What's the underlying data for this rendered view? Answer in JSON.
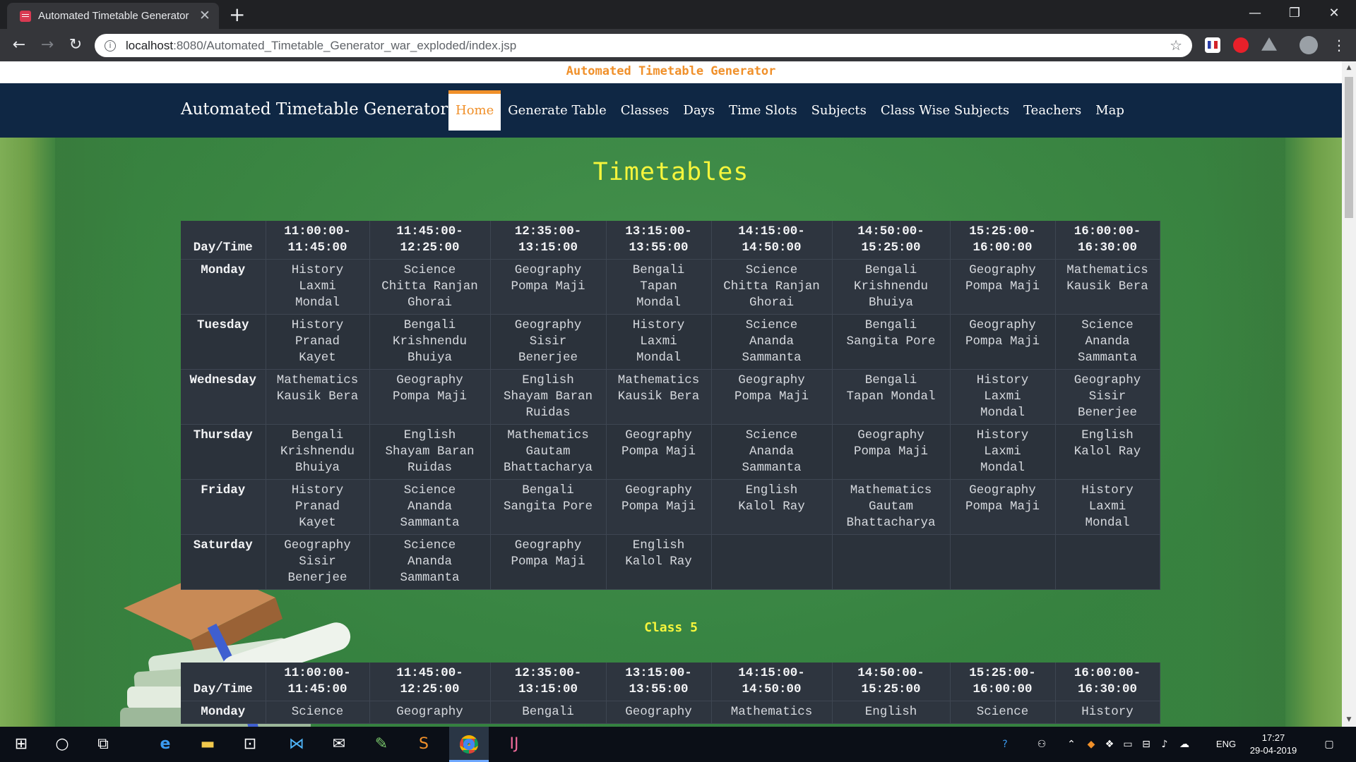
{
  "browser": {
    "tab_title": "Automated Timetable Generator",
    "tab_close": "✕",
    "new_tab": "+",
    "url_host": "localhost",
    "url_path": ":8080/Automated_Timetable_Generator_war_exploded/index.jsp",
    "win_min": "—",
    "win_max": "❐",
    "win_close": "✕"
  },
  "page": {
    "top_banner": "Automated Timetable Generator",
    "brand": "Automated Timetable Generator",
    "nav": [
      "Home",
      "Generate Table",
      "Classes",
      "Days",
      "Time Slots",
      "Subjects",
      "Class Wise Subjects",
      "Teachers",
      "Map"
    ],
    "heading": "Timetables",
    "timetable1": {
      "header": [
        "Day/Time",
        "11:00:00-\n11:45:00",
        "11:45:00-\n12:25:00",
        "12:35:00-\n13:15:00",
        "13:15:00-\n13:55:00",
        "14:15:00-\n14:50:00",
        "14:50:00-\n15:25:00",
        "15:25:00-\n16:00:00",
        "16:00:00-\n16:30:00"
      ],
      "rows": [
        {
          "day": "Monday",
          "cells": [
            "History\nLaxmi\nMondal",
            "Science\nChitta Ranjan\nGhorai",
            "Geography\nPompa Maji",
            "Bengali\nTapan\nMondal",
            "Science\nChitta Ranjan\nGhorai",
            "Bengali\nKrishnendu\nBhuiya",
            "Geography\nPompa Maji",
            "Mathematics\nKausik Bera"
          ]
        },
        {
          "day": "Tuesday",
          "cells": [
            "History\nPranad\nKayet",
            "Bengali\nKrishnendu\nBhuiya",
            "Geography\nSisir\nBenerjee",
            "History\nLaxmi\nMondal",
            "Science\nAnanda\nSammanta",
            "Bengali\nSangita Pore",
            "Geography\nPompa Maji",
            "Science\nAnanda\nSammanta"
          ]
        },
        {
          "day": "Wednesday",
          "cells": [
            "Mathematics\nKausik Bera",
            "Geography\nPompa Maji",
            "English\nShayam Baran\nRuidas",
            "Mathematics\nKausik Bera",
            "Geography\nPompa Maji",
            "Bengali\nTapan Mondal",
            "History\nLaxmi\nMondal",
            "Geography\nSisir\nBenerjee"
          ]
        },
        {
          "day": "Thursday",
          "cells": [
            "Bengali\nKrishnendu\nBhuiya",
            "English\nShayam Baran\nRuidas",
            "Mathematics\nGautam\nBhattacharya",
            "Geography\nPompa Maji",
            "Science\nAnanda\nSammanta",
            "Geography\nPompa Maji",
            "History\nLaxmi\nMondal",
            "English\nKalol Ray"
          ]
        },
        {
          "day": "Friday",
          "cells": [
            "History\nPranad\nKayet",
            "Science\nAnanda\nSammanta",
            "Bengali\nSangita Pore",
            "Geography\nPompa Maji",
            "English\nKalol Ray",
            "Mathematics\nGautam\nBhattacharya",
            "Geography\nPompa Maji",
            "History\nLaxmi\nMondal"
          ]
        },
        {
          "day": "Saturday",
          "cells": [
            "Geography\nSisir\nBenerjee",
            "Science\nAnanda\nSammanta",
            "Geography\nPompa Maji",
            "English\nKalol Ray",
            "",
            "",
            "",
            ""
          ]
        }
      ]
    },
    "class_label": "Class 5",
    "timetable2": {
      "header": [
        "Day/Time",
        "11:00:00-\n11:45:00",
        "11:45:00-\n12:25:00",
        "12:35:00-\n13:15:00",
        "13:15:00-\n13:55:00",
        "14:15:00-\n14:50:00",
        "14:50:00-\n15:25:00",
        "15:25:00-\n16:00:00",
        "16:00:00-\n16:30:00"
      ],
      "rows": [
        {
          "day": "Monday",
          "cells": [
            "Science",
            "Geography",
            "Bengali",
            "Geography",
            "Mathematics",
            "English",
            "Science",
            "History"
          ]
        }
      ]
    }
  },
  "taskbar": {
    "lang": "ENG",
    "time": "17:27",
    "date": "29-04-2019"
  },
  "colors": {
    "accent_orange": "#f0902a",
    "heading_yellow": "#f5f53c",
    "navbar": "#0f2744",
    "table_bg": "#2e353f"
  }
}
